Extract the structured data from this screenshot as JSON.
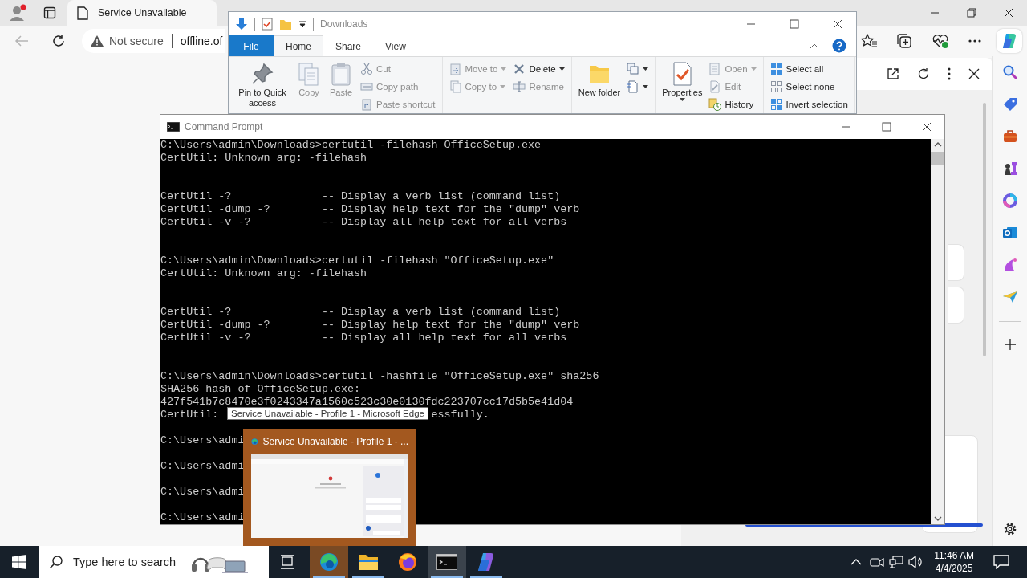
{
  "browser": {
    "tab": {
      "title": "Service Unavailable",
      "selected": true
    },
    "address": {
      "security": "Not secure",
      "url": "offline.of"
    }
  },
  "explorer": {
    "title": "Downloads",
    "ribbon_tabs": [
      {
        "label": "File",
        "kind": "file",
        "selected": false
      },
      {
        "label": "Home",
        "kind": "tab",
        "selected": true
      },
      {
        "label": "Share",
        "kind": "tab",
        "selected": false
      },
      {
        "label": "View",
        "kind": "tab",
        "selected": false
      }
    ],
    "groups": [
      {
        "columns": [
          {
            "kind": "large",
            "label": "Pin to Quick access",
            "disabled": false,
            "dropdown": false
          },
          {
            "kind": "large",
            "label": "Copy",
            "disabled": true,
            "dropdown": false
          },
          {
            "kind": "large",
            "label": "Paste",
            "disabled": true,
            "dropdown": false
          },
          {
            "kind": "stack",
            "items": [
              {
                "label": "Cut",
                "disabled": true,
                "dropdown": false
              },
              {
                "label": "Copy path",
                "disabled": true,
                "dropdown": false
              },
              {
                "label": "Paste shortcut",
                "disabled": true,
                "dropdown": false
              }
            ]
          }
        ]
      },
      {
        "columns": [
          {
            "kind": "stack",
            "items": [
              {
                "label": "Move to",
                "disabled": true,
                "dropdown": true
              },
              {
                "label": "Copy to",
                "disabled": true,
                "dropdown": true
              }
            ]
          },
          {
            "kind": "stack",
            "items": [
              {
                "label": "Delete",
                "disabled": false,
                "dropdown": true
              },
              {
                "label": "Rename",
                "disabled": true,
                "dropdown": false
              }
            ]
          }
        ]
      },
      {
        "columns": [
          {
            "kind": "large",
            "label": "New folder",
            "disabled": false,
            "dropdown": false
          },
          {
            "kind": "stack",
            "items": [
              {
                "disabled": false,
                "dropdown": true
              },
              {
                "disabled": false,
                "dropdown": true
              }
            ]
          }
        ]
      },
      {
        "columns": [
          {
            "kind": "large",
            "label": "Properties",
            "disabled": false,
            "dropdown": true
          },
          {
            "kind": "stack",
            "items": [
              {
                "label": "Open",
                "disabled": true,
                "dropdown": true
              },
              {
                "label": "Edit",
                "disabled": true,
                "dropdown": false
              },
              {
                "label": "History",
                "disabled": false,
                "dropdown": false
              }
            ]
          }
        ]
      },
      {
        "columns": [
          {
            "kind": "stack",
            "items": [
              {
                "label": "Select all",
                "disabled": false,
                "dropdown": false
              },
              {
                "label": "Select none",
                "disabled": false,
                "dropdown": false
              },
              {
                "label": "Invert selection",
                "disabled": false,
                "dropdown": false
              }
            ]
          }
        ]
      }
    ]
  },
  "console": {
    "title": "Command Prompt",
    "lines": [
      {
        "kind": "text",
        "text": "C:\\Users\\admin\\Downloads>certutil -filehash OfficeSetup.exe"
      },
      {
        "kind": "text",
        "text": "CertUtil: Unknown arg: -filehash"
      },
      {
        "kind": "blank"
      },
      {
        "kind": "blank"
      },
      {
        "kind": "text",
        "text": "CertUtil -?              -- Display a verb list (command list)"
      },
      {
        "kind": "text",
        "text": "CertUtil -dump -?        -- Display help text for the \"dump\" verb"
      },
      {
        "kind": "text",
        "text": "CertUtil -v -?           -- Display all help text for all verbs"
      },
      {
        "kind": "blank"
      },
      {
        "kind": "blank"
      },
      {
        "kind": "text",
        "text": "C:\\Users\\admin\\Downloads>certutil -filehash \"OfficeSetup.exe\""
      },
      {
        "kind": "text",
        "text": "CertUtil: Unknown arg: -filehash"
      },
      {
        "kind": "blank"
      },
      {
        "kind": "blank"
      },
      {
        "kind": "text",
        "text": "CertUtil -?              -- Display a verb list (command list)"
      },
      {
        "kind": "text",
        "text": "CertUtil -dump -?        -- Display help text for the \"dump\" verb"
      },
      {
        "kind": "text",
        "text": "CertUtil -v -?           -- Display all help text for all verbs"
      },
      {
        "kind": "blank"
      },
      {
        "kind": "blank"
      },
      {
        "kind": "text",
        "text": "C:\\Users\\admin\\Downloads>certutil -hashfile \"OfficeSetup.exe\" sha256"
      },
      {
        "kind": "text",
        "text": "SHA256 hash of OfficeSetup.exe:"
      },
      {
        "kind": "text",
        "text": "427f541b7c8470e3f0243347a1560c523c30e0130fdc223707cc17d5b5e41d04"
      },
      {
        "kind": "split",
        "parts": [
          "CertUtil:",
          "essfully."
        ]
      },
      {
        "kind": "blank"
      },
      {
        "kind": "text",
        "text": "C:\\Users\\admi"
      },
      {
        "kind": "blank"
      },
      {
        "kind": "text",
        "text": "C:\\Users\\admi"
      },
      {
        "kind": "blank"
      },
      {
        "kind": "text",
        "text": "C:\\Users\\admi"
      },
      {
        "kind": "blank"
      },
      {
        "kind": "text",
        "text": "C:\\Users\\admi"
      }
    ]
  },
  "tooltip": "Service Unavailable - Profile 1 - Microsoft Edge",
  "preview": {
    "title": "Service Unavailable - Profile 1 - ...",
    "kind": "picture"
  },
  "taskbar": {
    "search": {
      "placeholder": "Type here to search"
    },
    "apps": [
      {
        "running": true,
        "selected": false,
        "hovered": true
      },
      {
        "running": true,
        "selected": false,
        "hovered": false
      },
      {
        "running": false,
        "selected": false,
        "hovered": false
      },
      {
        "running": true,
        "selected": true,
        "hovered": false
      },
      {
        "running": true,
        "selected": false,
        "hovered": false
      }
    ],
    "time": "11:46 AM",
    "date": "4/4/2025"
  }
}
